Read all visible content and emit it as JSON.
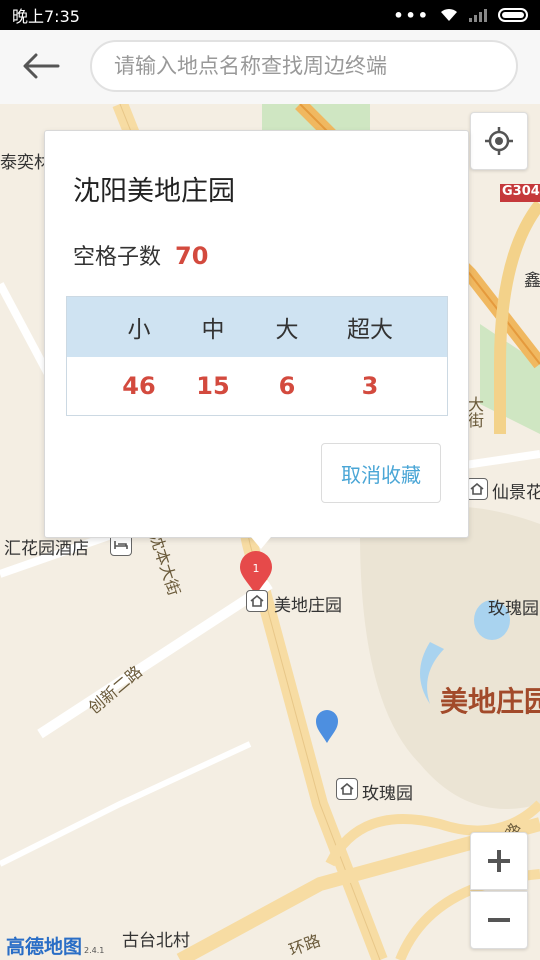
{
  "status_bar": {
    "time": "晚上7:35",
    "dots": "•••"
  },
  "search": {
    "placeholder": "请输入地点名称查找周边终端",
    "value": ""
  },
  "map": {
    "labels": {
      "tai_yi": "泰奕材",
      "g304": "G304",
      "xin": "鑫",
      "street_da": "大街",
      "xianjing": "仙景花",
      "hotel": "汇花园酒店",
      "road_shenben": "沈本大街",
      "poi_meidi": "美地庄园",
      "poi_meigui1": "玫瑰园",
      "road_chuangxin": "创新二路",
      "big_meidi": "美地庄园",
      "poi_meigui2": "玫瑰园",
      "gutai": "古台北村",
      "huanlu": "环路",
      "huanlu2": "环路"
    },
    "marker_number": "1",
    "logo": "高德地图",
    "logo_version": "2.4.1"
  },
  "card": {
    "title": "沈阳美地庄园",
    "count_label": "空格子数",
    "count_value": "70",
    "sizes": [
      "小",
      "中",
      "大",
      "超大"
    ],
    "values": [
      "46",
      "15",
      "6",
      "3"
    ],
    "unfavorite_label": "取消收藏"
  },
  "colors": {
    "accent_red": "#d34a3e",
    "table_head": "#cfe3f2",
    "link_blue": "#4aa6d6"
  }
}
